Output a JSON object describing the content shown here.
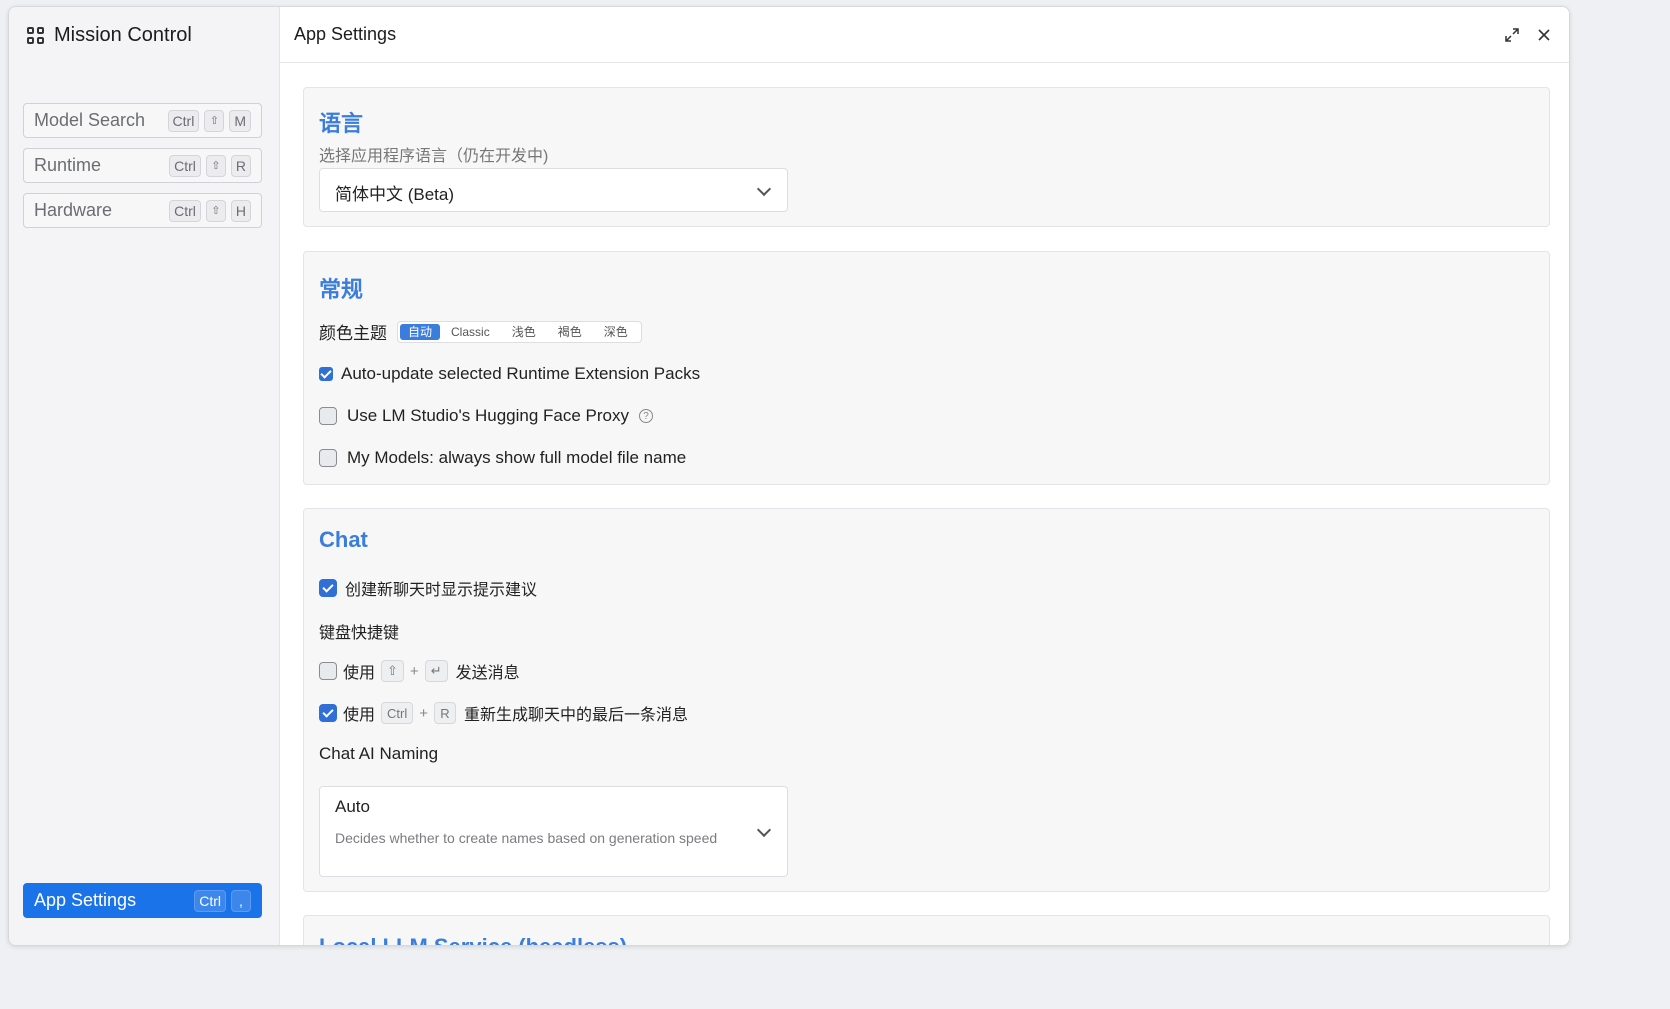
{
  "sidebar": {
    "title": "Mission Control",
    "items": [
      {
        "label": "Model Search",
        "keys": [
          "Ctrl",
          "⇧",
          "M"
        ]
      },
      {
        "label": "Runtime",
        "keys": [
          "Ctrl",
          "⇧",
          "R"
        ]
      },
      {
        "label": "Hardware",
        "keys": [
          "Ctrl",
          "⇧",
          "H"
        ]
      }
    ],
    "active_item": {
      "label": "App Settings",
      "keys": [
        "Ctrl",
        ","
      ]
    }
  },
  "header": {
    "title": "App Settings"
  },
  "language": {
    "title": "语言",
    "description": "选择应用程序语言（仍在开发中)",
    "selected": "简体中文 (Beta)"
  },
  "general": {
    "title": "常规",
    "theme_label": "颜色主题",
    "theme_options": [
      "自动",
      "Classic",
      "浅色",
      "褐色",
      "深色"
    ],
    "theme_selected": "自动",
    "auto_update_label": "Auto-update selected Runtime Extension Packs",
    "auto_update_checked": true,
    "hf_proxy_label": "Use LM Studio's Hugging Face Proxy",
    "hf_proxy_checked": false,
    "full_name_label": "My Models: always show full model file name",
    "full_name_checked": false
  },
  "chat": {
    "title": "Chat",
    "suggestions_label": "创建新聊天时显示提示建议",
    "suggestions_checked": true,
    "shortcuts_heading": "键盘快捷键",
    "send_prefix": "使用",
    "send_keys": [
      "⇧",
      "↵"
    ],
    "send_suffix": "发送消息",
    "send_checked": false,
    "regen_prefix": "使用",
    "regen_keys": [
      "Ctrl",
      "R"
    ],
    "regen_suffix": "重新生成聊天中的最后一条消息",
    "regen_checked": true,
    "plus": "+",
    "naming_label": "Chat AI Naming",
    "naming_value": "Auto",
    "naming_description": "Decides whether to create names based on generation speed"
  },
  "local_service": {
    "title": "Local LLM Service (headless)"
  },
  "colors": {
    "accent": "#1a73e8",
    "section_title": "#3b7ddd"
  }
}
